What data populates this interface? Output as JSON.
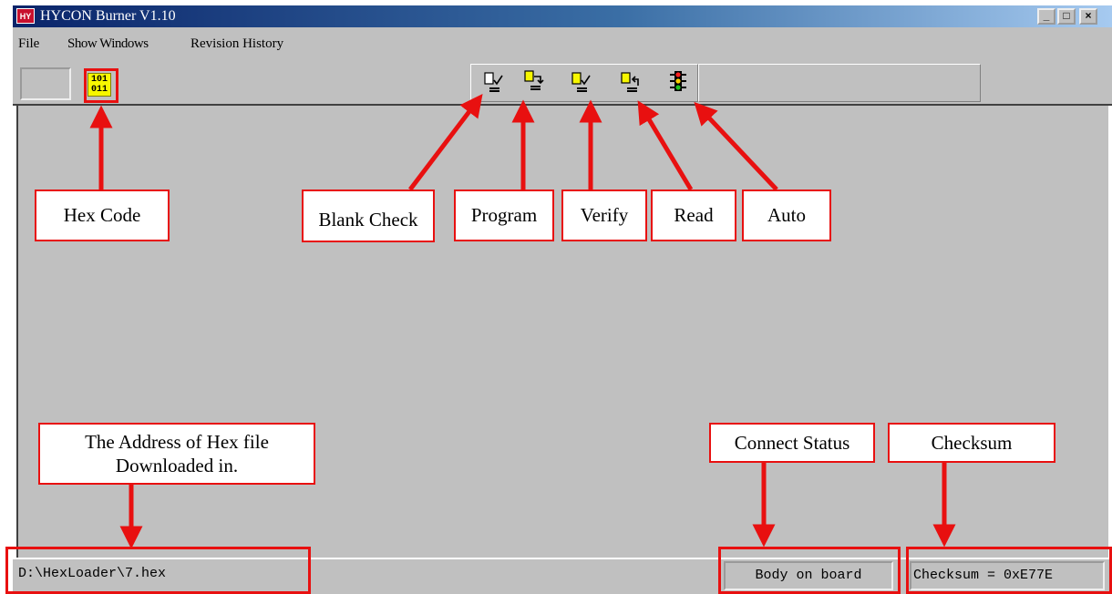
{
  "window": {
    "title": "HYCON Burner V1.10",
    "icon_text": "HY",
    "controls": {
      "minimize": "_",
      "maximize": "□",
      "close": "×"
    }
  },
  "menu": {
    "items": [
      {
        "label": "File"
      },
      {
        "label": "Show Windows"
      },
      {
        "label": "Revision History"
      }
    ]
  },
  "toolbar": {
    "hex_icon_text_top": "101",
    "hex_icon_text_bottom": "011",
    "buttons": [
      {
        "name": "blank-check",
        "icon": "blank-check-icon"
      },
      {
        "name": "program",
        "icon": "program-icon"
      },
      {
        "name": "verify",
        "icon": "verify-icon"
      },
      {
        "name": "read",
        "icon": "read-icon"
      },
      {
        "name": "auto",
        "icon": "traffic-light-icon"
      }
    ]
  },
  "status": {
    "path": "D:\\HexLoader\\7.hex",
    "connect": "Body on board",
    "checksum": "Checksum = 0xE77E"
  },
  "annotations": {
    "hex_code": "Hex Code",
    "blank_check": "Blank Check",
    "program": "Program",
    "verify": "Verify",
    "read": "Read",
    "auto": "Auto",
    "hex_address_line1": "The Address of Hex file",
    "hex_address_line2": "Downloaded in.",
    "connect_status": "Connect Status",
    "checksum": "Checksum"
  },
  "colors": {
    "accent_red": "#e81010",
    "title_bar": "#0a246a",
    "window_gray": "#c0c0c0"
  }
}
